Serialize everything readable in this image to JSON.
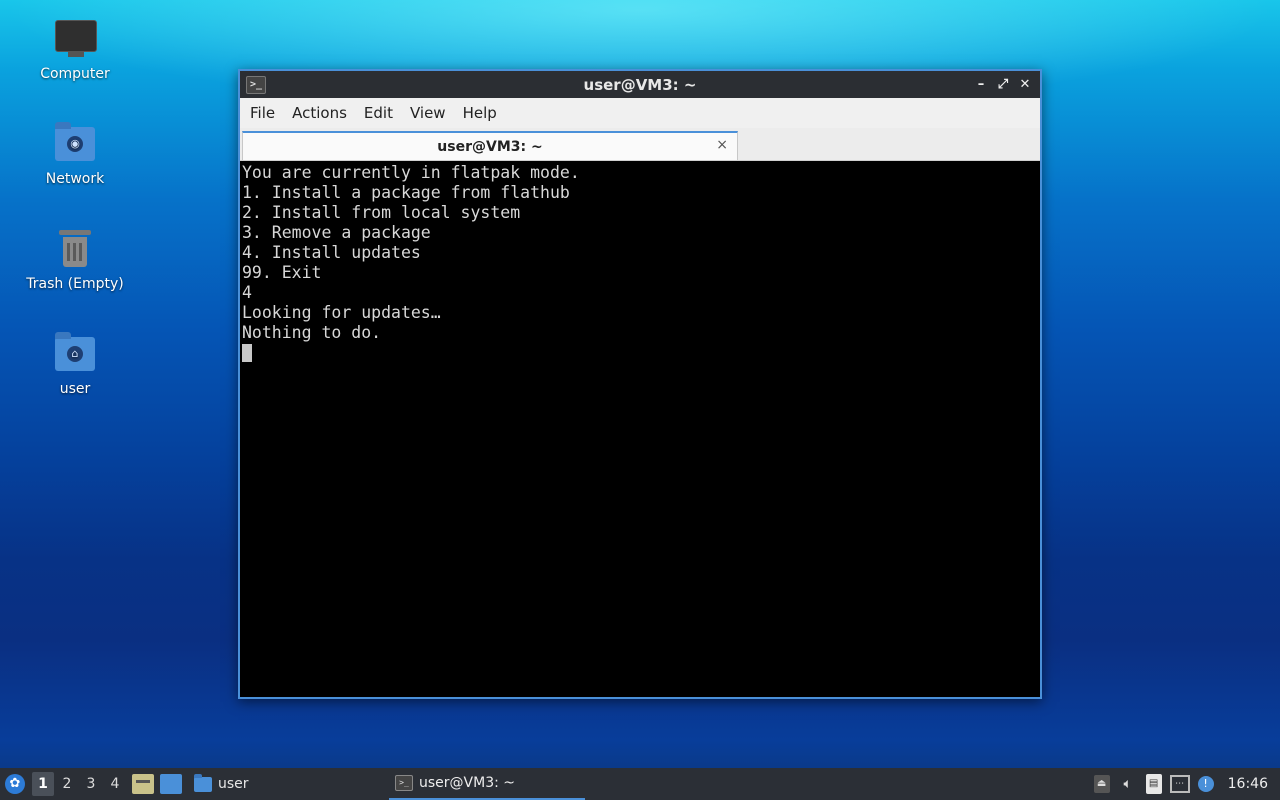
{
  "desktop": {
    "icons": [
      {
        "label": "Computer",
        "icon": "computer-icon"
      },
      {
        "label": "Network",
        "icon": "network-folder-icon"
      },
      {
        "label": "Trash (Empty)",
        "icon": "trash-icon"
      },
      {
        "label": "user",
        "icon": "home-folder-icon"
      }
    ]
  },
  "window": {
    "title": "user@VM3: ~",
    "menu": [
      "File",
      "Actions",
      "Edit",
      "View",
      "Help"
    ],
    "tab_label": "user@VM3: ~",
    "tab_close": "×"
  },
  "terminal": {
    "lines": [
      "You are currently in flatpak mode.",
      "1. Install a package from flathub",
      "2. Install from local system",
      "3. Remove a package",
      "4. Install updates",
      "99. Exit",
      "4",
      "Looking for updates…",
      "Nothing to do."
    ]
  },
  "taskbar": {
    "workspaces": [
      "1",
      "2",
      "3",
      "4"
    ],
    "active_workspace": "1",
    "folder_label": "user",
    "task_label": "user@VM3: ~",
    "clock": "16:46"
  },
  "colors": {
    "accent": "#4a90d9",
    "titlebar": "#2b2e33",
    "taskbar": "#2b2f36"
  }
}
